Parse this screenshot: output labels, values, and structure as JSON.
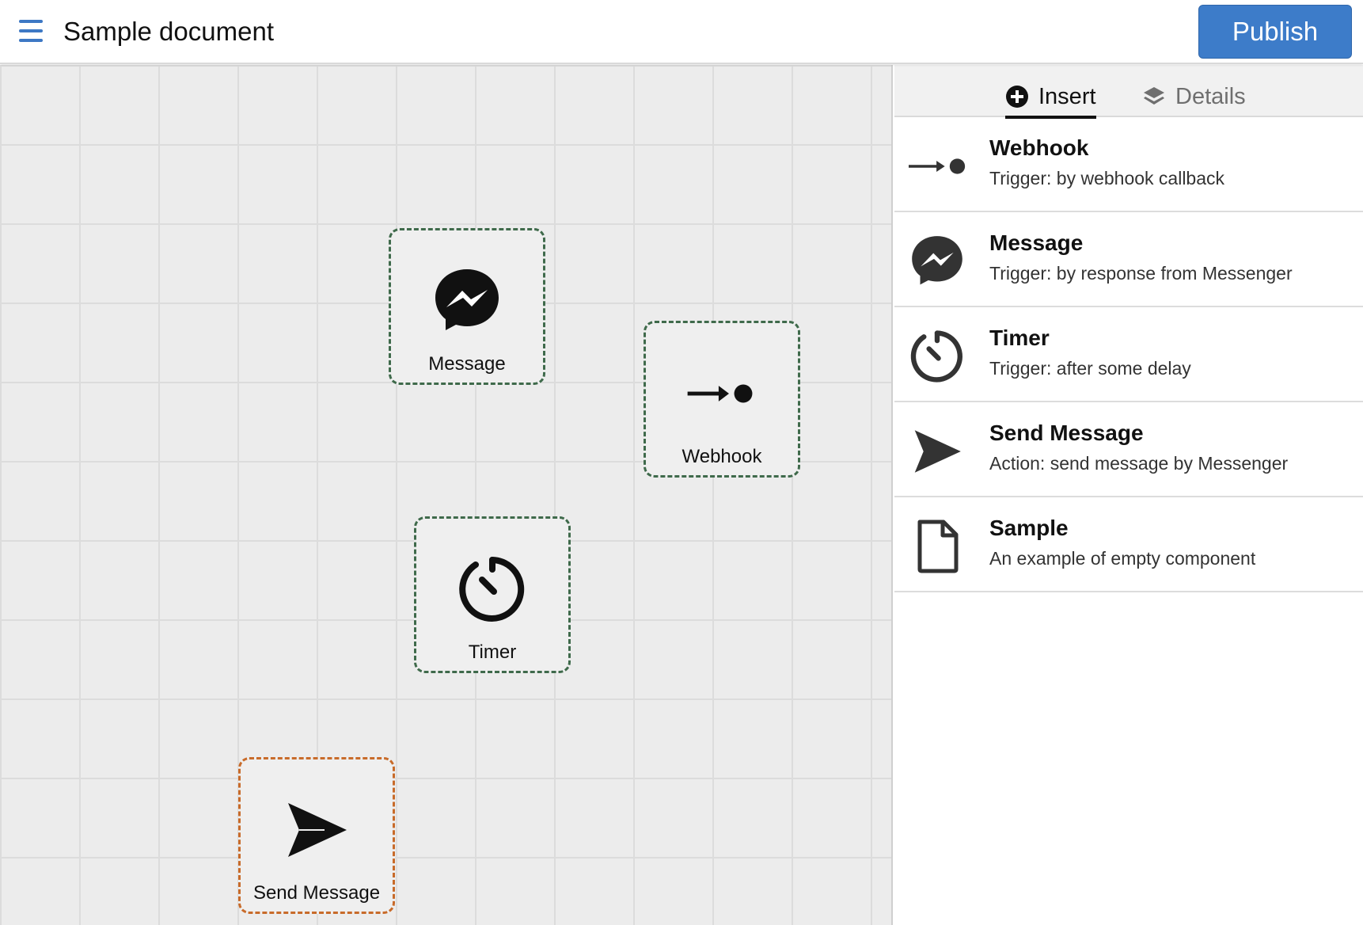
{
  "header": {
    "menu_icon": "hamburger-menu-icon",
    "title": "Sample document",
    "publish_label": "Publish",
    "accent_color": "#3d7cc9"
  },
  "canvas": {
    "nodes": [
      {
        "label": "Message",
        "icon": "messenger-icon",
        "border_color": "#3f6a4b"
      },
      {
        "label": "Webhook",
        "icon": "webhook-icon",
        "border_color": "#3f6a4b"
      },
      {
        "label": "Timer",
        "icon": "timer-icon",
        "border_color": "#3f6a4b"
      },
      {
        "label": "Send Message",
        "icon": "send-icon",
        "border_color": "#c86b2a"
      }
    ]
  },
  "panel": {
    "tabs": [
      {
        "label": "Insert",
        "icon": "plus-circle-icon",
        "active": true
      },
      {
        "label": "Details",
        "icon": "layers-icon",
        "active": false
      }
    ],
    "items": [
      {
        "title": "Webhook",
        "description": "Trigger: by webhook callback",
        "icon": "webhook-icon"
      },
      {
        "title": "Message",
        "description": "Trigger: by response from Messenger",
        "icon": "messenger-icon"
      },
      {
        "title": "Timer",
        "description": "Trigger: after some delay",
        "icon": "timer-icon"
      },
      {
        "title": "Send Message",
        "description": "Action: send message by Messenger",
        "icon": "send-icon"
      },
      {
        "title": "Sample",
        "description": "An example of empty component",
        "icon": "document-icon"
      }
    ]
  }
}
